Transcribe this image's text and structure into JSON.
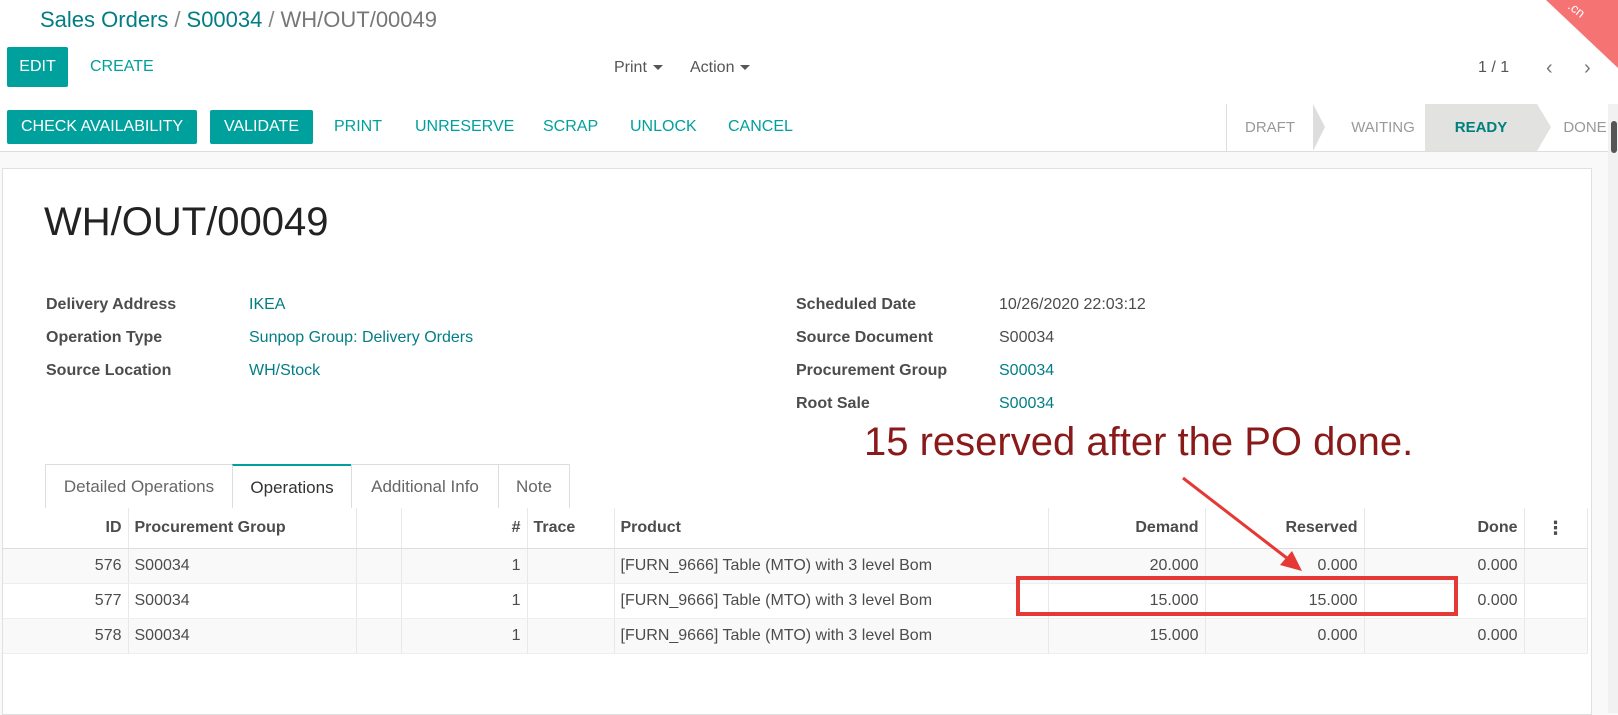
{
  "breadcrumb": {
    "root": "Sales Orders",
    "order": "S00034",
    "current": "WH/OUT/00049",
    "sep": "/"
  },
  "toolbar": {
    "edit": "EDIT",
    "create": "CREATE",
    "print": "Print",
    "action": "Action",
    "pager": "1 / 1",
    "prev_icon": "‹",
    "next_icon": "›"
  },
  "watermark": ".cn",
  "statusbar": {
    "buttons": [
      "CHECK AVAILABILITY",
      "VALIDATE"
    ],
    "links": [
      "PRINT",
      "UNRESERVE",
      "SCRAP",
      "UNLOCK",
      "CANCEL"
    ],
    "stages": [
      "DRAFT",
      "WAITING",
      "READY",
      "DONE"
    ],
    "active_stage": "READY"
  },
  "record": {
    "title": "WH/OUT/00049",
    "left": [
      {
        "label": "Delivery Address",
        "value": "IKEA"
      },
      {
        "label": "Operation Type",
        "value": "Sunpop Group: Delivery Orders"
      },
      {
        "label": "Source Location",
        "value": "WH/Stock"
      }
    ],
    "right": [
      {
        "label": "Scheduled Date",
        "value": "10/26/2020 22:03:12"
      },
      {
        "label": "Source Document",
        "value": "S00034"
      },
      {
        "label": "Procurement Group",
        "value": "S00034"
      },
      {
        "label": "Root Sale",
        "value": "S00034"
      }
    ]
  },
  "annotation": "15 reserved after the PO done.",
  "tabs": [
    "Detailed Operations",
    "Operations",
    "Additional Info",
    "Note"
  ],
  "active_tab": "Operations",
  "table": {
    "headers": [
      "ID",
      "Procurement Group",
      "",
      "#",
      "Trace",
      "Product",
      "Demand",
      "Reserved",
      "Done"
    ],
    "kebab_icon": "⋮",
    "rows": [
      {
        "id": "576",
        "group": "S00034",
        "num": "1",
        "product": "[FURN_9666] Table (MTO) with 3 level Bom",
        "demand": "20.000",
        "reserved": "0.000",
        "done": "0.000"
      },
      {
        "id": "577",
        "group": "S00034",
        "num": "1",
        "product": "[FURN_9666] Table (MTO) with 3 level Bom",
        "demand": "15.000",
        "reserved": "15.000",
        "done": "0.000"
      },
      {
        "id": "578",
        "group": "S00034",
        "num": "1",
        "product": "[FURN_9666] Table (MTO) with 3 level Bom",
        "demand": "15.000",
        "reserved": "0.000",
        "done": "0.000"
      }
    ]
  },
  "colors": {
    "accent": "#00a09d",
    "link": "#017e84",
    "annotation": "#8a1a1a",
    "highlight": "#e53935"
  }
}
